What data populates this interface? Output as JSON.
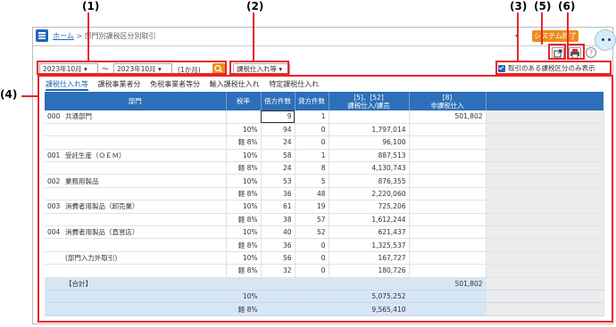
{
  "callouts": {
    "c1": "(1)",
    "c2": "(2)",
    "c3": "(3)",
    "c4": "(4)",
    "c5": "(5)",
    "c6": "(6)"
  },
  "header": {
    "home_link": "ホーム",
    "separator": ">",
    "page_title": "部門別課税区分別取引",
    "system_button": "システム終了"
  },
  "filters": {
    "from_month": "2023年10月",
    "tilde": "〜",
    "to_month": "2023年10月",
    "period": "(1か月)",
    "category": "課税仕入れ等",
    "only_with_transactions": "取引のある課税区分のみ表示"
  },
  "tabs": [
    "課税仕入れ等",
    "課税事業者分",
    "免税事業者等分",
    "輸入課税仕入れ",
    "特定課税仕入れ"
  ],
  "table": {
    "headers": {
      "dept": "部門",
      "rate": "税率",
      "debit": "借方件数",
      "credit": "貸方件数",
      "taxable_1": "[5]、[52]",
      "taxable_2": "課税仕入/課売",
      "nontax_1": "[8]",
      "nontax_2": "非課税仕入"
    },
    "rows": [
      {
        "code": "000",
        "name": "共通部門",
        "rate": "",
        "debit": "9",
        "credit": "1",
        "taxable": "",
        "nontax": "501,802"
      },
      {
        "code": "",
        "name": "",
        "rate": "10%",
        "debit": "94",
        "credit": "0",
        "taxable": "1,797,014",
        "nontax": ""
      },
      {
        "code": "",
        "name": "",
        "rate": "軽 8%",
        "debit": "24",
        "credit": "0",
        "taxable": "96,100",
        "nontax": ""
      },
      {
        "code": "001",
        "name": "受託生産（ＯＥＭ）",
        "rate": "10%",
        "debit": "58",
        "credit": "1",
        "taxable": "887,513",
        "nontax": ""
      },
      {
        "code": "",
        "name": "",
        "rate": "軽 8%",
        "debit": "24",
        "credit": "8",
        "taxable": "4,130,743",
        "nontax": ""
      },
      {
        "code": "002",
        "name": "業務用製品",
        "rate": "10%",
        "debit": "53",
        "credit": "5",
        "taxable": "876,355",
        "nontax": ""
      },
      {
        "code": "",
        "name": "",
        "rate": "軽 8%",
        "debit": "36",
        "credit": "48",
        "taxable": "2,220,060",
        "nontax": ""
      },
      {
        "code": "003",
        "name": "消費者用製品（卸売業）",
        "rate": "10%",
        "debit": "61",
        "credit": "19",
        "taxable": "725,206",
        "nontax": ""
      },
      {
        "code": "",
        "name": "",
        "rate": "軽 8%",
        "debit": "38",
        "credit": "57",
        "taxable": "1,612,244",
        "nontax": ""
      },
      {
        "code": "004",
        "name": "消費者用製品（直営店）",
        "rate": "10%",
        "debit": "40",
        "credit": "52",
        "taxable": "621,437",
        "nontax": ""
      },
      {
        "code": "",
        "name": "",
        "rate": "軽 8%",
        "debit": "36",
        "credit": "0",
        "taxable": "1,325,537",
        "nontax": ""
      },
      {
        "code": "",
        "name": "(部門入力外取引)",
        "rate": "10%",
        "debit": "56",
        "credit": "0",
        "taxable": "167,727",
        "nontax": ""
      },
      {
        "code": "",
        "name": "",
        "rate": "軽 8%",
        "debit": "32",
        "credit": "0",
        "taxable": "180,726",
        "nontax": ""
      }
    ],
    "totals": [
      {
        "name": "【合計】",
        "rate": "",
        "taxable": "",
        "nontax": "501,802"
      },
      {
        "name": "",
        "rate": "10%",
        "taxable": "5,075,252",
        "nontax": ""
      },
      {
        "name": "",
        "rate": "軽 8%",
        "taxable": "9,565,410",
        "nontax": ""
      }
    ]
  },
  "icons": [
    "menu-icon",
    "export-icon",
    "print-icon",
    "help-icon",
    "search-icon",
    "checkbox-icon",
    "avatar-icon"
  ],
  "colors": {
    "accent": "#1f64b8",
    "orange": "#f08c1e",
    "callout_red": "#e8242a",
    "total_row": "#d6e6f5"
  }
}
